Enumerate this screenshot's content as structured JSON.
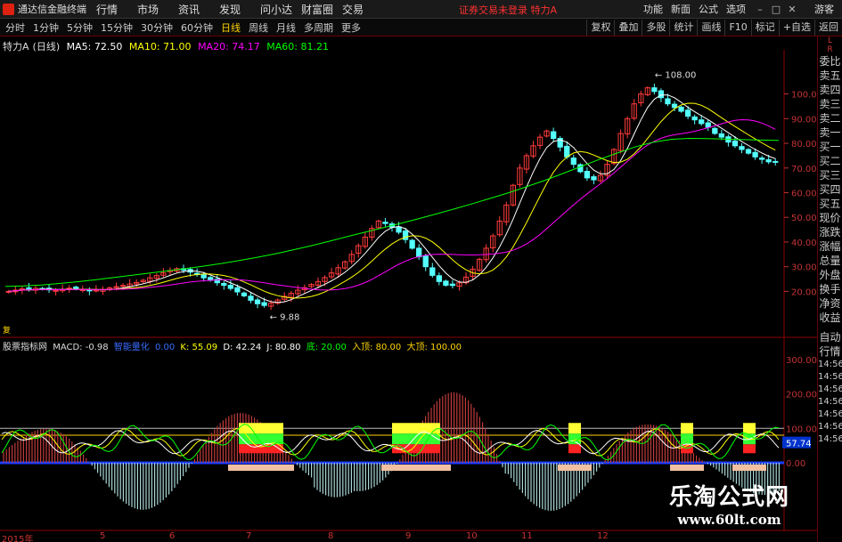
{
  "menubar": {
    "app_title": "通达信金融终端",
    "items": [
      "行情",
      "市场",
      "资讯",
      "发现",
      "问小达",
      "财富圈",
      "交易"
    ],
    "status": "证券交易未登录 特力A",
    "right_items": [
      "功能",
      "新面",
      "公式",
      "选项"
    ],
    "guest": "游客"
  },
  "periods": [
    "分时",
    "1分钟",
    "5分钟",
    "15分钟",
    "30分钟",
    "60分钟",
    "日线",
    "周线",
    "月线",
    "多周期",
    "更多"
  ],
  "active_period": "日线",
  "tools": [
    "复权",
    "叠加",
    "多股",
    "统计",
    "画线",
    "F10",
    "标记",
    "+自选",
    "返回"
  ],
  "ma_legend": {
    "stock": "特力A",
    "period": "(日线)",
    "ma5": "MA5: 72.50",
    "ma10": "MA10: 71.00",
    "ma20": "MA20: 74.17",
    "ma60": "MA60: 81.21"
  },
  "colors": {
    "up": "#ff3b3b",
    "down": "#54ffff",
    "ma5": "#ffffff",
    "ma10": "#ffff00",
    "ma20": "#ff00ff",
    "ma60": "#00ff00",
    "axis": "#c33333"
  },
  "right_panel": {
    "top": [
      "L",
      "R"
    ],
    "items": [
      "委比",
      "卖五",
      "卖四",
      "卖三",
      "卖二",
      "卖一",
      "买一",
      "买二",
      "买三",
      "买四",
      "买五",
      "现价",
      "涨跌",
      "涨幅",
      "总量",
      "外盘",
      "换手",
      "净资",
      "收益"
    ],
    "lower": [
      "自动",
      "行情"
    ],
    "times": [
      "14:56",
      "14:56",
      "14:56",
      "14:56",
      "14:56",
      "14:56",
      "14:56"
    ]
  },
  "indicator_legend": {
    "name": "股票指标网",
    "macd": "MACD: -0.98",
    "sig": "智能量化",
    "dif": "0.00",
    "k": "K: 55.09",
    "d": "D: 42.24",
    "j": "J: 80.80",
    "di": "底: 20.00",
    "ru": "入顶: 80.00",
    "da": "大顶: 100.00"
  },
  "price_axis": [
    "100.00",
    "90.00",
    "80.00",
    "70.00",
    "60.00",
    "50.00",
    "40.00",
    "30.00",
    "20.00"
  ],
  "ind_axis": [
    "300.00",
    "200.00",
    "100.00",
    "57.74",
    "0.00"
  ],
  "ind_current": "57.74",
  "annotations": {
    "high": "108.00",
    "low": "9.88",
    "corner": "复"
  },
  "dates": [
    "2015年",
    "5",
    "6",
    "7",
    "8",
    "9",
    "10",
    "11",
    "12"
  ],
  "watermark": {
    "title": "乐淘公式网",
    "url": "www.60lt.com"
  },
  "chart_data": {
    "type": "candlestick",
    "ylim": [
      5,
      115
    ],
    "high_marker": 108.0,
    "low_marker": 9.88,
    "closes": [
      20,
      20.5,
      21,
      20.8,
      21.2,
      21,
      20.6,
      20.4,
      20.8,
      21.3,
      21,
      20.7,
      20.2,
      20.5,
      20.8,
      21.4,
      21.9,
      22.4,
      23,
      23.6,
      24.5,
      25.5,
      26.4,
      27.5,
      28.5,
      29.2,
      28.6,
      27.8,
      26.8,
      25.5,
      24.5,
      23.5,
      22.5,
      21.2,
      19.8,
      18.2,
      16.4,
      15,
      14.3,
      15.2,
      16.5,
      18,
      19.2,
      20.5,
      21.5,
      22.8,
      24,
      25.6,
      27.5,
      29.6,
      32,
      35,
      38.5,
      42,
      45.5,
      48.5,
      47.5,
      46,
      44,
      41,
      37.5,
      34,
      30,
      26.5,
      24,
      22.5,
      22.4,
      23.5,
      25.8,
      29,
      33,
      37.5,
      42.5,
      48.5,
      55,
      63,
      70,
      75,
      79,
      82.5,
      85,
      82,
      78.5,
      74.5,
      71.5,
      68.5,
      66,
      65.2,
      67,
      71.5,
      77.5,
      84,
      90,
      96,
      100,
      102.5,
      101,
      98.5,
      96,
      94.5,
      93,
      91,
      89.5,
      88,
      86.5,
      84,
      82.5,
      80.5,
      79,
      77.5,
      76,
      74.5,
      73.5,
      72.5,
      72.5
    ],
    "ma60": [
      22,
      22.2,
      22.6,
      23.2,
      23.9,
      24.7,
      25.6,
      26.5,
      27.4,
      28.3,
      29.2,
      30.2,
      31.3,
      32.5,
      33.8,
      35.2,
      36.8,
      38.5,
      40.3,
      42.2,
      44,
      45.8,
      47.6,
      49.5,
      51.5,
      53.5,
      55.6,
      57.8,
      60,
      62.5,
      65,
      67.8,
      70.6,
      73.4,
      76,
      78.5,
      80.4,
      81.6,
      82,
      81.9,
      81.7,
      81.5,
      81.3,
      81.21
    ]
  }
}
